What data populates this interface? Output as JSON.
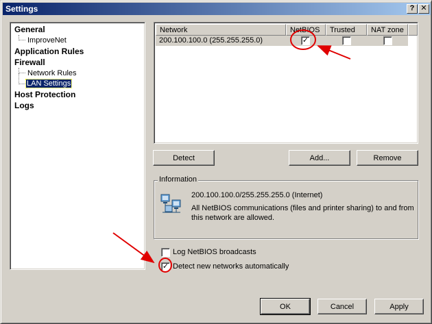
{
  "window": {
    "title": "Settings"
  },
  "caption_buttons": {
    "help": "?",
    "close": "✕"
  },
  "tree": {
    "items": [
      {
        "label": "General"
      },
      {
        "label": "ImproveNet"
      },
      {
        "label": "Application Rules"
      },
      {
        "label": "Firewall"
      },
      {
        "label": "Network Rules"
      },
      {
        "label": "LAN Settings"
      },
      {
        "label": "Host Protection"
      },
      {
        "label": "Logs"
      }
    ],
    "selected": "LAN Settings"
  },
  "networks_table": {
    "columns": [
      "Network",
      "NetBIOS",
      "Trusted",
      "NAT zone"
    ],
    "rows": [
      {
        "network": "200.100.100.0 (255.255.255.0)",
        "netbios": true,
        "trusted": false,
        "nat_zone": false
      }
    ]
  },
  "buttons": {
    "detect": "Detect",
    "add": "Add...",
    "remove": "Remove"
  },
  "information": {
    "title": "Information",
    "network_line": "200.100.100.0/255.255.255.0 (Internet)",
    "desc_line1": "All NetBIOS communications (files and printer sharing) to and from",
    "desc_line2": "this network are allowed.",
    "icon": "network-computers-icon"
  },
  "options": {
    "log_netbios": {
      "label": "Log NetBIOS broadcasts",
      "checked": false
    },
    "detect_networks": {
      "label": "Detect new networks automatically",
      "checked": true
    }
  },
  "footer": {
    "ok": "OK",
    "cancel": "Cancel",
    "apply": "Apply"
  },
  "colors": {
    "annotation": "#e00000",
    "titlebar_start": "#0a246a",
    "titlebar_end": "#a6caf0",
    "selection": "#0a246a"
  }
}
